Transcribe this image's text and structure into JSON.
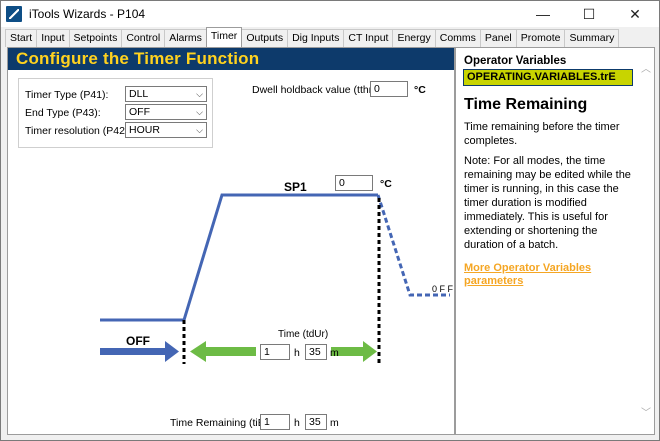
{
  "window": {
    "title": "iTools Wizards - P104",
    "controls": {
      "minimize": "—",
      "maximize": "☐",
      "close": "✕"
    }
  },
  "tabs": [
    {
      "label": "Start"
    },
    {
      "label": "Input"
    },
    {
      "label": "Setpoints"
    },
    {
      "label": "Control"
    },
    {
      "label": "Alarms"
    },
    {
      "label": "Timer"
    },
    {
      "label": "Outputs"
    },
    {
      "label": "Dig Inputs"
    },
    {
      "label": "CT Input"
    },
    {
      "label": "Energy"
    },
    {
      "label": "Comms"
    },
    {
      "label": "Panel"
    },
    {
      "label": "Promote"
    },
    {
      "label": "Summary"
    }
  ],
  "active_tab": "Timer",
  "main": {
    "title": "Configure the Timer Function",
    "settings": {
      "timer_type_label": "Timer Type (P41):",
      "timer_type_value": "DLL",
      "end_type_label": "End Type (P43):",
      "end_type_value": "OFF",
      "resolution_label": "Timer resolution (P42):",
      "resolution_value": "HOUR"
    },
    "dwell": {
      "label": "Dwell holdback value (tthr):",
      "value": "0",
      "unit": "°C"
    },
    "diagram": {
      "sp_label": "SP1",
      "sp_value": "0",
      "sp_unit": "°C",
      "off_label": "OFF",
      "end_off_label": "0 F F",
      "time_label": "Time (tdUr)",
      "time_hours": "1",
      "time_h_unit": "h",
      "time_minutes": "35",
      "time_m_unit": "m"
    },
    "remaining": {
      "label": "Time Remaining (tiE):",
      "hours": "1",
      "h_unit": "h",
      "minutes": "35",
      "m_unit": "m"
    }
  },
  "help": {
    "section_title": "Operator Variables",
    "variable": "OPERATING.VARIABLES.trE",
    "heading": "Time Remaining",
    "body1": "Time remaining before the timer completes.",
    "body2": "Note: For all modes, the time remaining may be edited while the timer is running, in this case the timer duration is modified immediately. This is useful for extending or shortening the duration of a batch.",
    "link": "More Operator Variables parameters"
  },
  "colors": {
    "header_bg": "#0d3a6b",
    "header_text": "#ffd21f",
    "profile_blue": "#4466b4",
    "arrow_green": "#6dbb45",
    "variable_bg": "#c8d400",
    "link": "#f5a623"
  }
}
